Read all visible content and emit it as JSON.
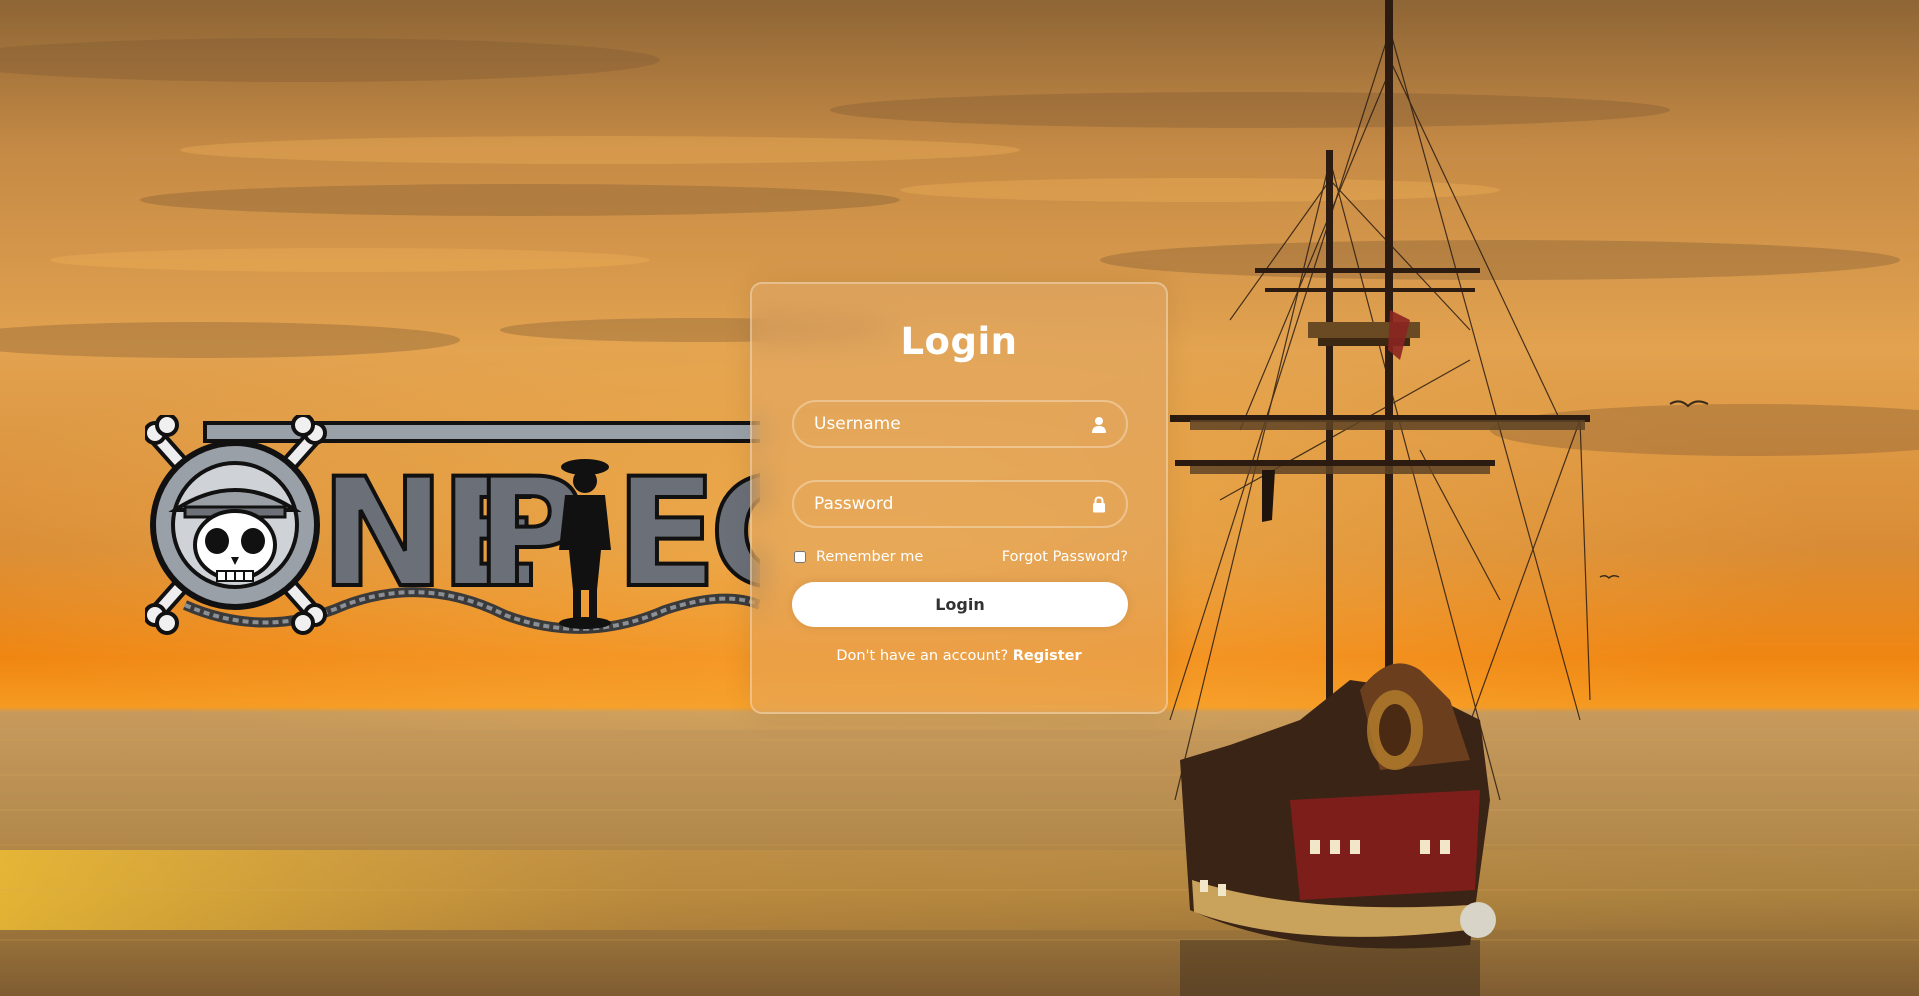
{
  "login": {
    "title": "Login",
    "username_placeholder": "Username",
    "password_placeholder": "Password",
    "remember_label": "Remember me",
    "forgot_label": "Forgot Password?",
    "submit_label": "Login",
    "register_prompt": "Don't have an account?",
    "register_label": "Register"
  },
  "logo": {
    "text": "ONE PIECE"
  },
  "icons": {
    "username": "user-icon",
    "password": "lock-icon"
  },
  "colors": {
    "sky_top": "#9c6a35",
    "sky_mid": "#e7a24d",
    "horizon": "#f08a14",
    "sea": "#b78a4a",
    "card_fill": "rgba(225,170,110,0.42)",
    "button_bg": "#ffffff",
    "button_text": "#333333"
  }
}
